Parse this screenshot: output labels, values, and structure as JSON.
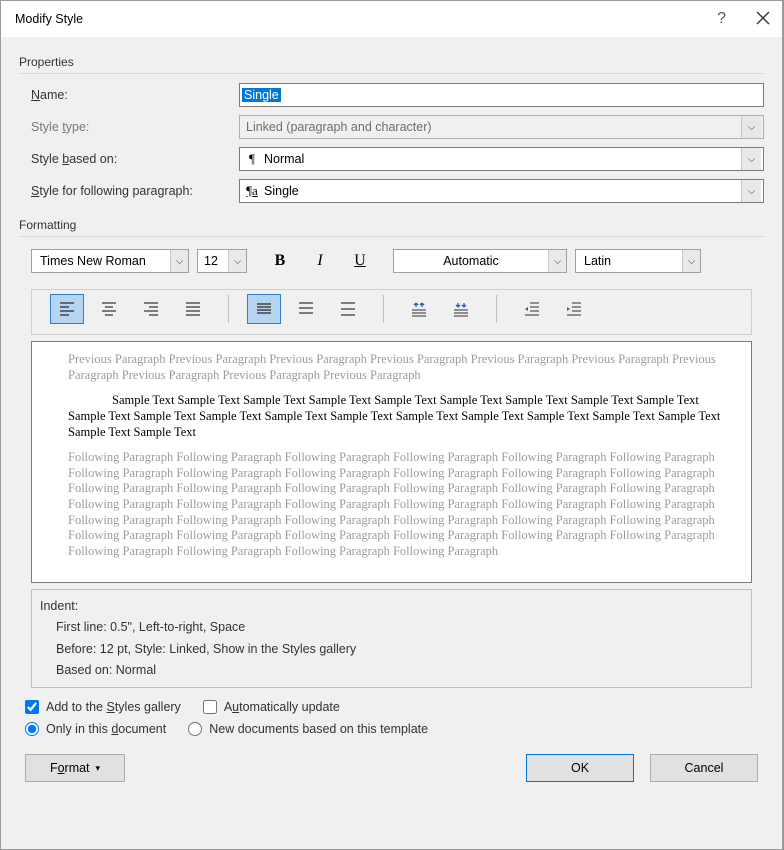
{
  "titlebar": {
    "title": "Modify Style",
    "help": "?",
    "close": "✕"
  },
  "properties": {
    "group_label": "Properties",
    "name_label": "Name:",
    "name_value": "Single",
    "type_label": "Style type:",
    "type_value": "Linked (paragraph and character)",
    "based_label": "Style based on:",
    "based_value": "Normal",
    "following_label": "Style for following paragraph:",
    "following_value": "Single"
  },
  "formatting": {
    "group_label": "Formatting",
    "font_name": "Times New Roman",
    "font_size": "12",
    "color_text": "Automatic",
    "script_text": "Latin"
  },
  "preview": {
    "prev_text": "Previous Paragraph Previous Paragraph Previous Paragraph Previous Paragraph Previous Paragraph Previous Paragraph Previous Paragraph Previous Paragraph Previous Paragraph Previous Paragraph",
    "sample_text": "Sample Text Sample Text Sample Text Sample Text Sample Text Sample Text Sample Text Sample Text Sample Text Sample Text Sample Text Sample Text Sample Text Sample Text Sample Text Sample Text Sample Text Sample Text Sample Text Sample Text Sample Text",
    "follow_text": "Following Paragraph Following Paragraph Following Paragraph Following Paragraph Following Paragraph Following Paragraph Following Paragraph Following Paragraph Following Paragraph Following Paragraph Following Paragraph Following Paragraph Following Paragraph Following Paragraph Following Paragraph Following Paragraph Following Paragraph Following Paragraph Following Paragraph Following Paragraph Following Paragraph Following Paragraph Following Paragraph Following Paragraph Following Paragraph Following Paragraph Following Paragraph Following Paragraph Following Paragraph Following Paragraph Following Paragraph Following Paragraph Following Paragraph Following Paragraph Following Paragraph Following Paragraph Following Paragraph Following Paragraph Following Paragraph Following Paragraph"
  },
  "description": {
    "l1": "Indent:",
    "l2": "First line:  0.5\", Left-to-right, Space",
    "l3": "Before:  12 pt, Style: Linked, Show in the Styles gallery",
    "l4": "Based on: Normal"
  },
  "options": {
    "add_gallery": "Add to the Styles gallery",
    "auto_update": "Automatically update",
    "only_doc": "Only in this document",
    "new_template": "New documents based on this template"
  },
  "buttons": {
    "format": "Format",
    "ok": "OK",
    "cancel": "Cancel"
  }
}
